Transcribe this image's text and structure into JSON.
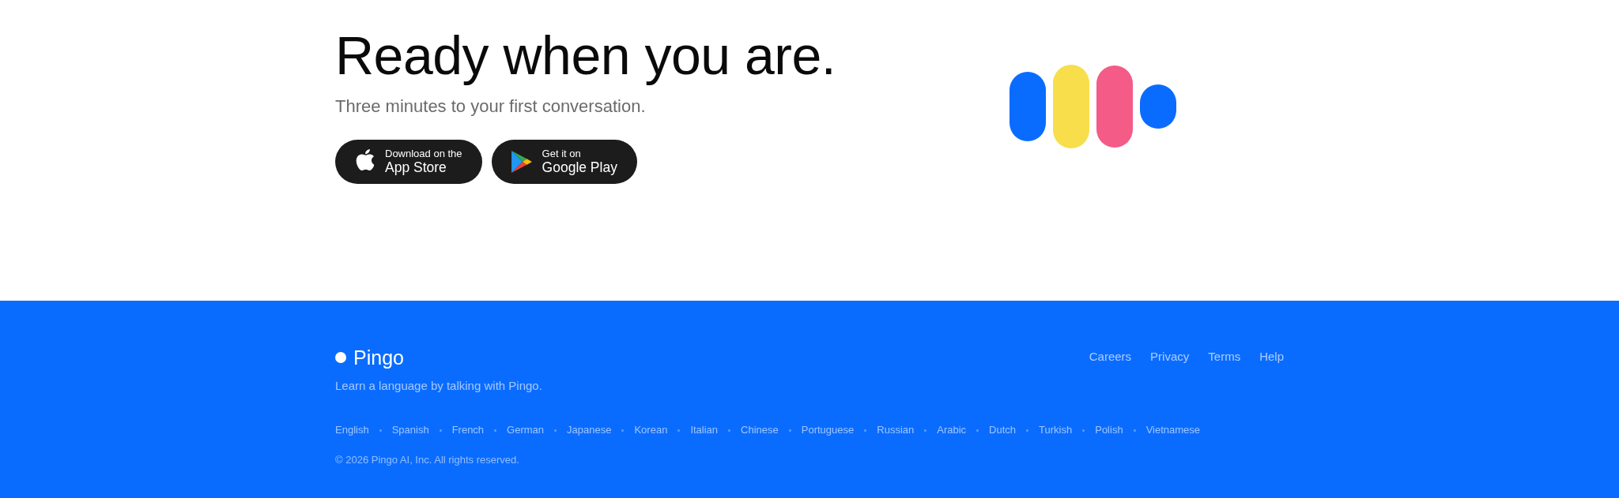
{
  "hero": {
    "title": "Ready when you are.",
    "subtitle": "Three minutes to your first conversation.",
    "store_buttons": [
      {
        "kind": "apple",
        "caption": "Download on the",
        "label": "App Store"
      },
      {
        "kind": "google",
        "caption": "Get it on",
        "label": "Google Play"
      }
    ]
  },
  "footer": {
    "brand": "Pingo",
    "tagline": "Learn a language by talking with Pingo.",
    "links": [
      "Careers",
      "Privacy",
      "Terms",
      "Help"
    ],
    "languages": [
      "English",
      "Spanish",
      "French",
      "German",
      "Japanese",
      "Korean",
      "Italian",
      "Chinese",
      "Portuguese",
      "Russian",
      "Arabic",
      "Dutch",
      "Turkish",
      "Polish",
      "Vietnamese"
    ],
    "copyright": "© 2026 Pingo AI, Inc. All rights reserved."
  }
}
